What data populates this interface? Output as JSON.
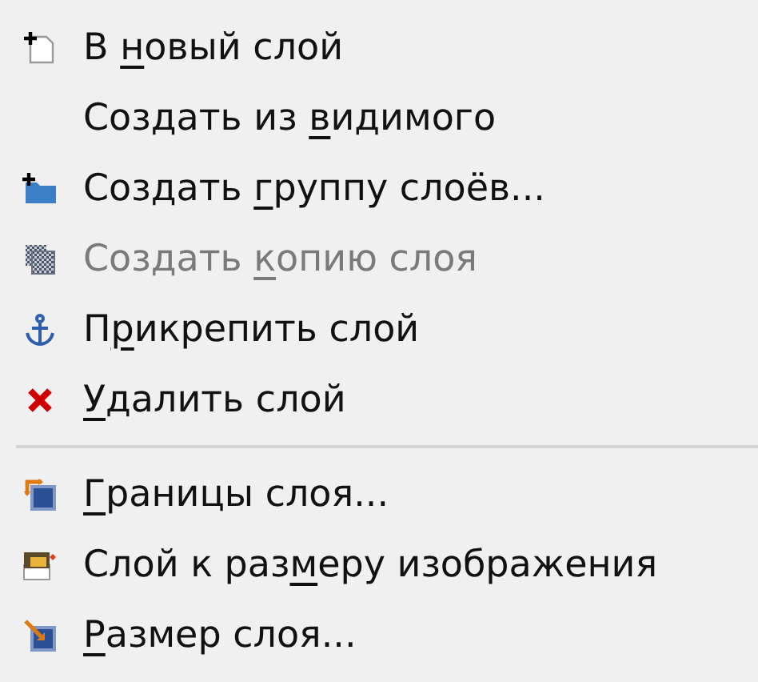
{
  "menu": {
    "groups": [
      {
        "items": [
          {
            "before": "В ",
            "key": "н",
            "after": "овый слой",
            "disabled": false
          },
          {
            "before": "Создать из ",
            "key": "в",
            "after": "идимого",
            "disabled": false
          },
          {
            "before": "Создать ",
            "key": "г",
            "after": "руппу слоёв...",
            "disabled": false
          },
          {
            "before": "Создать ",
            "key": "к",
            "after": "опию слоя",
            "disabled": true
          },
          {
            "before": "П",
            "key": "р",
            "after": "икрепить слой",
            "disabled": false
          },
          {
            "key": "У",
            "after": "далить слой",
            "disabled": false
          }
        ]
      },
      {
        "items": [
          {
            "key": "Г",
            "after": "раницы слоя...",
            "disabled": false
          },
          {
            "before": "Слой к раз",
            "key": "м",
            "after": "еру изображения",
            "disabled": false
          },
          {
            "key": "Р",
            "after": "азмер слоя...",
            "disabled": false
          }
        ]
      }
    ]
  }
}
